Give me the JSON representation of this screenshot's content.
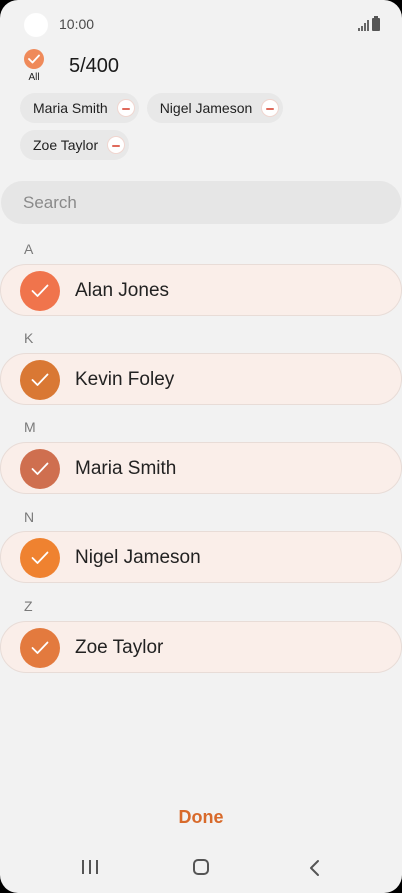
{
  "status_bar": {
    "time": "10:00"
  },
  "header": {
    "all_label": "All",
    "selected_count": "5/400"
  },
  "selected_chips": [
    {
      "label": "Maria Smith"
    },
    {
      "label": "Nigel Jameson"
    },
    {
      "label": "Zoe Taylor"
    }
  ],
  "search": {
    "placeholder": "Search"
  },
  "contacts": [
    {
      "letter": "A",
      "name": "Alan Jones",
      "checked": true,
      "color": "#f0744c"
    },
    {
      "letter": "K",
      "name": "Kevin Foley",
      "checked": true,
      "color": "#d97834"
    },
    {
      "letter": "M",
      "name": "Maria Smith",
      "checked": true,
      "color": "#cf6f4f"
    },
    {
      "letter": "N",
      "name": "Nigel Jameson",
      "checked": true,
      "color": "#ef8230"
    },
    {
      "letter": "Z",
      "name": "Zoe Taylor",
      "checked": true,
      "color": "#e37a3e"
    }
  ],
  "footer": {
    "done_label": "Done"
  },
  "colors": {
    "accent": "#d86a2b",
    "row_background": "#faeee9",
    "all_check": "#ef8a5a"
  },
  "icons": {
    "check": "check-icon",
    "remove": "remove-icon",
    "nav_recents": "recents-icon",
    "nav_home": "home-icon",
    "nav_back": "back-icon"
  }
}
